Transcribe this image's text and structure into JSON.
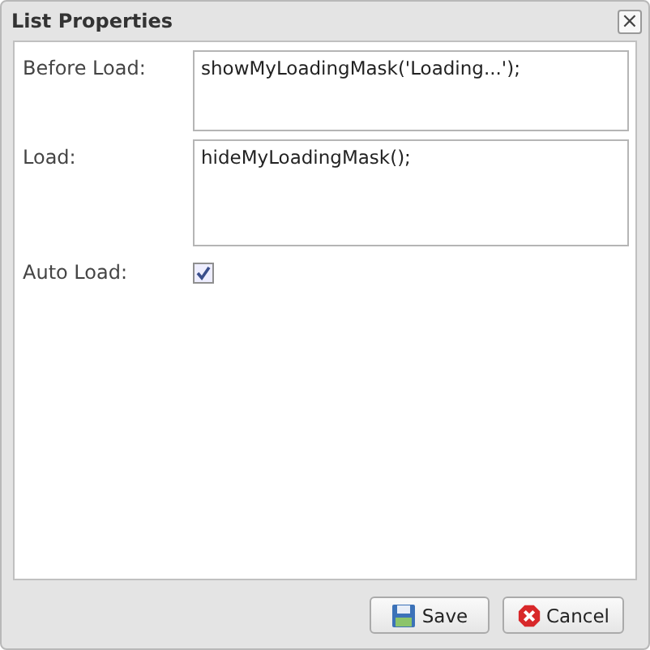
{
  "window": {
    "title": "List Properties",
    "close_label": "×"
  },
  "fields": [
    {
      "kind": "textarea",
      "label": "Before Load:",
      "value": "showMyLoadingMask('Loading...');"
    },
    {
      "kind": "textarea",
      "label": "Load:",
      "value": "hideMyLoadingMask();"
    },
    {
      "kind": "checkbox",
      "label": "Auto Load:",
      "checked": true
    }
  ],
  "buttons": [
    {
      "kind": "save",
      "label": "Save"
    },
    {
      "kind": "cancel",
      "label": "Cancel"
    }
  ]
}
